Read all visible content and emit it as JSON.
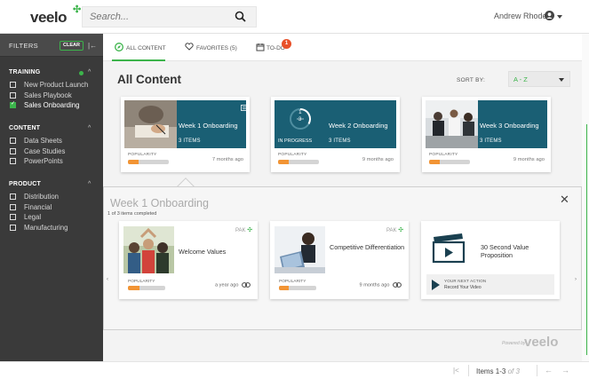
{
  "brand": {
    "logo": "veelo",
    "accent": "#3cb44b",
    "teal": "#1a5f74",
    "orange": "#f29434",
    "badge": "#e8512a"
  },
  "header": {
    "search_placeholder": "Search...",
    "user_name": "Andrew Rhodes"
  },
  "sidebar": {
    "title": "FILTERS",
    "clear_label": "CLEAR",
    "sections": [
      {
        "title": "TRAINING",
        "items": [
          {
            "label": "New Product Launch",
            "checked": false
          },
          {
            "label": "Sales Playbook",
            "checked": false
          },
          {
            "label": "Sales Onboarding",
            "checked": true
          }
        ]
      },
      {
        "title": "CONTENT",
        "items": [
          {
            "label": "Data Sheets",
            "checked": false
          },
          {
            "label": "Case Studies",
            "checked": false
          },
          {
            "label": "PowerPoints",
            "checked": false
          }
        ]
      },
      {
        "title": "PRODUCT",
        "items": [
          {
            "label": "Distribution",
            "checked": false
          },
          {
            "label": "Financial",
            "checked": false
          },
          {
            "label": "Legal",
            "checked": false
          },
          {
            "label": "Manufacturing",
            "checked": false
          }
        ]
      }
    ]
  },
  "tabs": [
    {
      "label": "ALL CONTENT",
      "active": true
    },
    {
      "label": "FAVORITES (5)",
      "active": false
    },
    {
      "label": "TO-DO",
      "active": false,
      "badge": "1"
    }
  ],
  "main": {
    "title": "All Content",
    "sort_label": "SORT BY:",
    "sort_value": "A - Z"
  },
  "cards": [
    {
      "title": "Week 1 Onboarding",
      "items": "3 ITEMS",
      "popularity_label": "POPULARITY",
      "popularity": 0.25,
      "time": "7 months ago",
      "progress": ""
    },
    {
      "title": "Week 2 Onboarding",
      "items": "3 ITEMS",
      "popularity_label": "POPULARITY",
      "popularity": 0.25,
      "time": "9 months ago",
      "progress": "IN PROGRESS",
      "ring_num": "1",
      "ring_den": "3"
    },
    {
      "title": "Week 3 Onboarding",
      "items": "3 ITEMS",
      "popularity_label": "POPULARITY",
      "popularity": 0.25,
      "time": "9 months ago",
      "progress": ""
    }
  ],
  "panel": {
    "title": "Week 1 Onboarding",
    "subtitle": "1 of 3 items completed",
    "items": [
      {
        "title": "Welcome Values",
        "pak": "PAK",
        "popularity_label": "POPULARITY",
        "popularity": 0.3,
        "time": "a year ago"
      },
      {
        "title": "Competitive Differentiation",
        "pak": "PAK",
        "popularity_label": "POPULARITY",
        "popularity": 0.25,
        "time": "9 months ago"
      },
      {
        "title": "30 Second Value Proposition",
        "next_label": "YOUR NEXT ACTION",
        "next_action": "Record Your Video"
      }
    ]
  },
  "powered_by": "Powered by",
  "powered_logo": "veelo",
  "pager": {
    "range": "Items 1-3",
    "of": "of 3"
  }
}
